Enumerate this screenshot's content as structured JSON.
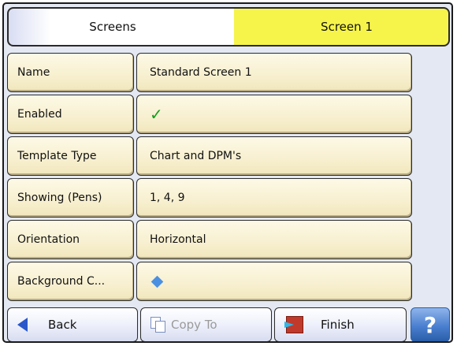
{
  "breadcrumb": {
    "parent_label": "Screens",
    "current_label": "Screen 1"
  },
  "rows": [
    {
      "label": "Name",
      "value": "Standard Screen 1"
    },
    {
      "label": "Enabled",
      "value": "✓"
    },
    {
      "label": "Template Type",
      "value": "Chart and DPM's"
    },
    {
      "label": "Showing (Pens)",
      "value": "1, 4, 9"
    },
    {
      "label": "Orientation",
      "value": "Horizontal"
    },
    {
      "label": "Background C...",
      "value": ""
    }
  ],
  "toolbar": {
    "back_label": "Back",
    "copy_label": "Copy To",
    "finish_label": "Finish",
    "help_label": "?"
  },
  "colors": {
    "current_crumb": "#f6f44a",
    "row_fill": "#f7efcf",
    "enabled_check": "#11a11a",
    "background_color_swatch": "#4a90e2",
    "help_button": "#4a7fd0"
  },
  "icons": {
    "back": "back-arrow-icon",
    "copy": "copy-icon",
    "finish": "finish-icon",
    "swatch": "diamond-icon"
  }
}
